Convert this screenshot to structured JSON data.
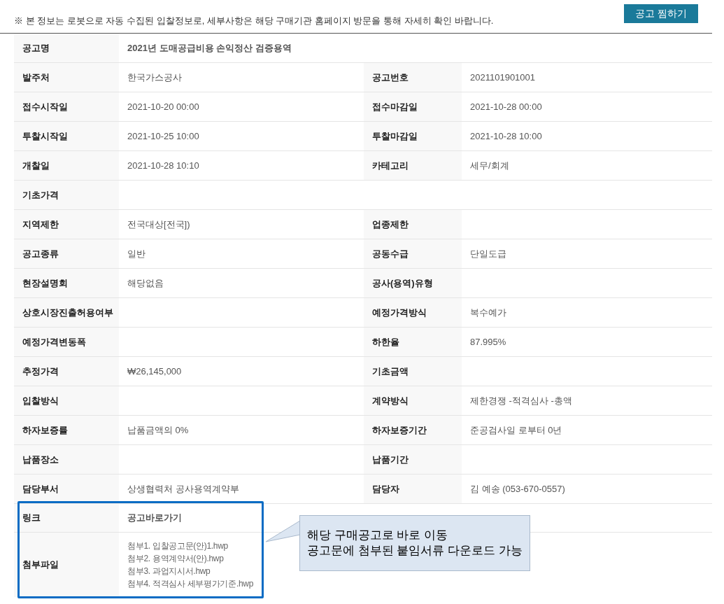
{
  "notice": "※ 본 정보는 로봇으로 자동 수집된 입찰정보로, 세부사항은 해당 구매기관 홈페이지 방문을 통해 자세히 확인 바랍니다.",
  "bookmark_button": "공고 찜하기",
  "title_row": {
    "label": "공고명",
    "value": "2021년 도매공급비용 손익정산 검증용역"
  },
  "rows": [
    {
      "cells": [
        {
          "label": "발주처",
          "value": "한국가스공사"
        },
        {
          "label": "공고번호",
          "value": "2021101901001"
        }
      ]
    },
    {
      "cells": [
        {
          "label": "접수시작일",
          "value": "2021-10-20 00:00"
        },
        {
          "label": "접수마감일",
          "value": "2021-10-28 00:00"
        }
      ]
    },
    {
      "cells": [
        {
          "label": "투찰시작일",
          "value": "2021-10-25 10:00"
        },
        {
          "label": "투찰마감일",
          "value": "2021-10-28 10:00"
        }
      ]
    },
    {
      "cells": [
        {
          "label": "개찰일",
          "value": "2021-10-28 10:10"
        },
        {
          "label": "카테고리",
          "value": "세무/회계"
        }
      ]
    },
    {
      "cells": [
        {
          "label": "기초가격"
        }
      ]
    },
    {
      "cells": [
        {
          "label": "지역제한",
          "value": "전국대상[전국])"
        },
        {
          "label": "업종제한"
        }
      ]
    },
    {
      "cells": [
        {
          "label": "공고종류",
          "value": "일반"
        },
        {
          "label": "공동수급",
          "value": "단일도급"
        }
      ]
    },
    {
      "cells": [
        {
          "label": "현장설명회",
          "value": "해당없음"
        },
        {
          "label": "공사(용역)유형"
        }
      ]
    },
    {
      "cells": [
        {
          "label": "상호시장진출허용여부"
        },
        {
          "label": "예정가격방식",
          "value": "복수예가"
        }
      ]
    },
    {
      "cells": [
        {
          "label": "예정가격변동폭"
        },
        {
          "label": "하한율",
          "value": "87.995%"
        }
      ]
    },
    {
      "cells": [
        {
          "label": "추정가격",
          "value": "₩26,145,000"
        },
        {
          "label": "기초금액"
        }
      ]
    },
    {
      "cells": [
        {
          "label": "입찰방식"
        },
        {
          "label": "계약방식",
          "value": "제한경쟁 -적격심사 -총액"
        }
      ]
    },
    {
      "cells": [
        {
          "label": "하자보증률",
          "value": "납품금액의 0%"
        },
        {
          "label": "하자보증기간",
          "value": "준공검사일 로부터 0년"
        }
      ]
    },
    {
      "cells": [
        {
          "label": "납품장소"
        },
        {
          "label": "납품기간"
        }
      ]
    },
    {
      "cells": [
        {
          "label": "담당부서",
          "value": "상생협력처 공사용역계약부"
        },
        {
          "label": "담당자",
          "value": "김 예송 (053-670-0557)"
        }
      ]
    }
  ],
  "link_row": {
    "label": "링크",
    "link": "공고바로가기"
  },
  "attachments": {
    "label": "첨부파일",
    "files": [
      "첨부1. 입찰공고문(안)1.hwp",
      "첨부2. 용역계약서(안).hwp",
      "첨부3. 과업지시서.hwp",
      "첨부4. 적격심사 세부평가기준.hwp"
    ]
  },
  "callout": [
    "해당 구매공고로 바로 이동",
    "공고문에 첨부된 붙임서류 다운로드 가능"
  ]
}
